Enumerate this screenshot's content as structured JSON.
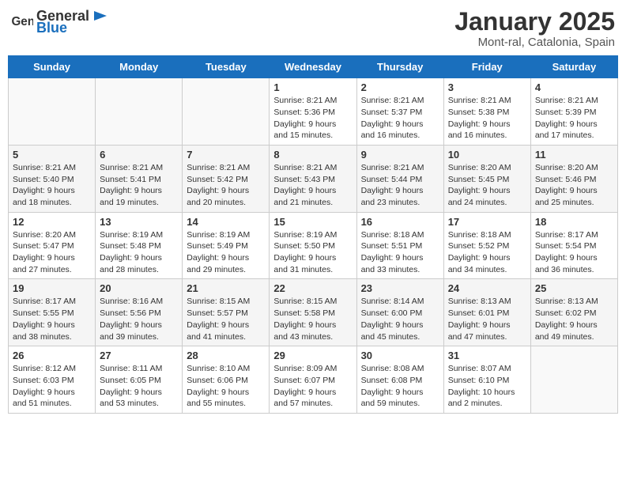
{
  "header": {
    "logo": {
      "text_general": "General",
      "text_blue": "Blue"
    },
    "title": "January 2025",
    "location": "Mont-ral, Catalonia, Spain"
  },
  "calendar": {
    "columns": [
      "Sunday",
      "Monday",
      "Tuesday",
      "Wednesday",
      "Thursday",
      "Friday",
      "Saturday"
    ],
    "weeks": [
      [
        {
          "day": "",
          "info": ""
        },
        {
          "day": "",
          "info": ""
        },
        {
          "day": "",
          "info": ""
        },
        {
          "day": "1",
          "info": "Sunrise: 8:21 AM\nSunset: 5:36 PM\nDaylight: 9 hours and 15 minutes."
        },
        {
          "day": "2",
          "info": "Sunrise: 8:21 AM\nSunset: 5:37 PM\nDaylight: 9 hours and 16 minutes."
        },
        {
          "day": "3",
          "info": "Sunrise: 8:21 AM\nSunset: 5:38 PM\nDaylight: 9 hours and 16 minutes."
        },
        {
          "day": "4",
          "info": "Sunrise: 8:21 AM\nSunset: 5:39 PM\nDaylight: 9 hours and 17 minutes."
        }
      ],
      [
        {
          "day": "5",
          "info": "Sunrise: 8:21 AM\nSunset: 5:40 PM\nDaylight: 9 hours and 18 minutes."
        },
        {
          "day": "6",
          "info": "Sunrise: 8:21 AM\nSunset: 5:41 PM\nDaylight: 9 hours and 19 minutes."
        },
        {
          "day": "7",
          "info": "Sunrise: 8:21 AM\nSunset: 5:42 PM\nDaylight: 9 hours and 20 minutes."
        },
        {
          "day": "8",
          "info": "Sunrise: 8:21 AM\nSunset: 5:43 PM\nDaylight: 9 hours and 21 minutes."
        },
        {
          "day": "9",
          "info": "Sunrise: 8:21 AM\nSunset: 5:44 PM\nDaylight: 9 hours and 23 minutes."
        },
        {
          "day": "10",
          "info": "Sunrise: 8:20 AM\nSunset: 5:45 PM\nDaylight: 9 hours and 24 minutes."
        },
        {
          "day": "11",
          "info": "Sunrise: 8:20 AM\nSunset: 5:46 PM\nDaylight: 9 hours and 25 minutes."
        }
      ],
      [
        {
          "day": "12",
          "info": "Sunrise: 8:20 AM\nSunset: 5:47 PM\nDaylight: 9 hours and 27 minutes."
        },
        {
          "day": "13",
          "info": "Sunrise: 8:19 AM\nSunset: 5:48 PM\nDaylight: 9 hours and 28 minutes."
        },
        {
          "day": "14",
          "info": "Sunrise: 8:19 AM\nSunset: 5:49 PM\nDaylight: 9 hours and 29 minutes."
        },
        {
          "day": "15",
          "info": "Sunrise: 8:19 AM\nSunset: 5:50 PM\nDaylight: 9 hours and 31 minutes."
        },
        {
          "day": "16",
          "info": "Sunrise: 8:18 AM\nSunset: 5:51 PM\nDaylight: 9 hours and 33 minutes."
        },
        {
          "day": "17",
          "info": "Sunrise: 8:18 AM\nSunset: 5:52 PM\nDaylight: 9 hours and 34 minutes."
        },
        {
          "day": "18",
          "info": "Sunrise: 8:17 AM\nSunset: 5:54 PM\nDaylight: 9 hours and 36 minutes."
        }
      ],
      [
        {
          "day": "19",
          "info": "Sunrise: 8:17 AM\nSunset: 5:55 PM\nDaylight: 9 hours and 38 minutes."
        },
        {
          "day": "20",
          "info": "Sunrise: 8:16 AM\nSunset: 5:56 PM\nDaylight: 9 hours and 39 minutes."
        },
        {
          "day": "21",
          "info": "Sunrise: 8:15 AM\nSunset: 5:57 PM\nDaylight: 9 hours and 41 minutes."
        },
        {
          "day": "22",
          "info": "Sunrise: 8:15 AM\nSunset: 5:58 PM\nDaylight: 9 hours and 43 minutes."
        },
        {
          "day": "23",
          "info": "Sunrise: 8:14 AM\nSunset: 6:00 PM\nDaylight: 9 hours and 45 minutes."
        },
        {
          "day": "24",
          "info": "Sunrise: 8:13 AM\nSunset: 6:01 PM\nDaylight: 9 hours and 47 minutes."
        },
        {
          "day": "25",
          "info": "Sunrise: 8:13 AM\nSunset: 6:02 PM\nDaylight: 9 hours and 49 minutes."
        }
      ],
      [
        {
          "day": "26",
          "info": "Sunrise: 8:12 AM\nSunset: 6:03 PM\nDaylight: 9 hours and 51 minutes."
        },
        {
          "day": "27",
          "info": "Sunrise: 8:11 AM\nSunset: 6:05 PM\nDaylight: 9 hours and 53 minutes."
        },
        {
          "day": "28",
          "info": "Sunrise: 8:10 AM\nSunset: 6:06 PM\nDaylight: 9 hours and 55 minutes."
        },
        {
          "day": "29",
          "info": "Sunrise: 8:09 AM\nSunset: 6:07 PM\nDaylight: 9 hours and 57 minutes."
        },
        {
          "day": "30",
          "info": "Sunrise: 8:08 AM\nSunset: 6:08 PM\nDaylight: 9 hours and 59 minutes."
        },
        {
          "day": "31",
          "info": "Sunrise: 8:07 AM\nSunset: 6:10 PM\nDaylight: 10 hours and 2 minutes."
        },
        {
          "day": "",
          "info": ""
        }
      ]
    ]
  }
}
